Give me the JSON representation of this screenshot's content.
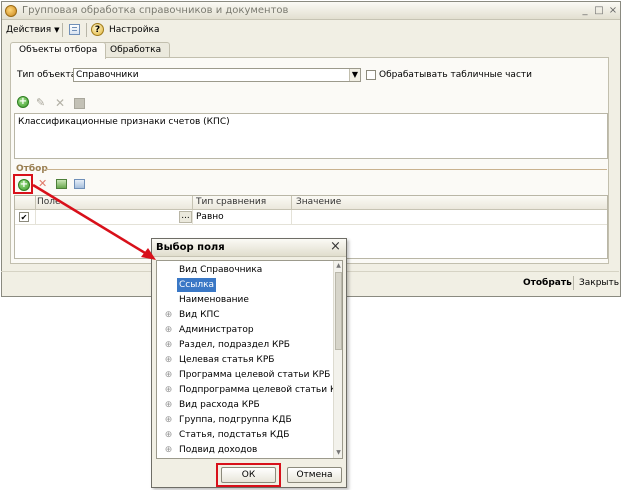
{
  "window": {
    "title": "Групповая обработка справочников и документов",
    "controls": [
      "_",
      "□",
      "×"
    ]
  },
  "toolbar": {
    "actions_label": "Действия",
    "settings_label": "Настройка",
    "help_icon": "?"
  },
  "tabs": [
    {
      "label": "Объекты отбора",
      "active": true
    },
    {
      "label": "Обработка",
      "active": false
    }
  ],
  "object_type": {
    "label": "Тип объекта:",
    "value": "Справочники",
    "process_tables_label": "Обрабатывать табличные части",
    "process_tables_checked": false
  },
  "objects_list": {
    "items": [
      "Классификационные признаки счетов (КПС)"
    ]
  },
  "filter": {
    "section_title": "Отбор",
    "columns": [
      "Поле",
      "Тип сравнения",
      "Значение"
    ],
    "rows": [
      {
        "checked": true,
        "field": "",
        "ellipsis": "...",
        "comparison": "Равно",
        "value": ""
      }
    ]
  },
  "bottom": {
    "select_button": "Отобрать",
    "close_button": "Закрыть"
  },
  "dialog": {
    "title": "Выбор поля",
    "close_icon": "×",
    "items": [
      {
        "label": "Вид Справочника",
        "expandable": false,
        "selected": false
      },
      {
        "label": "Ссылка",
        "expandable": false,
        "selected": true
      },
      {
        "label": "Наименование",
        "expandable": false,
        "selected": false
      },
      {
        "label": "Вид КПС",
        "expandable": true,
        "selected": false
      },
      {
        "label": "Администратор",
        "expandable": true,
        "selected": false
      },
      {
        "label": "Раздел, подраздел КРБ",
        "expandable": true,
        "selected": false
      },
      {
        "label": "Целевая статья КРБ",
        "expandable": true,
        "selected": false
      },
      {
        "label": "Программа целевой статьи КРБ",
        "expandable": true,
        "selected": false
      },
      {
        "label": "Подпрограмма целевой статьи КРБ",
        "expandable": true,
        "selected": false
      },
      {
        "label": "Вид расхода КРБ",
        "expandable": true,
        "selected": false
      },
      {
        "label": "Группа, подгруппа КДБ",
        "expandable": true,
        "selected": false
      },
      {
        "label": "Статья, подстатья КДБ",
        "expandable": true,
        "selected": false
      },
      {
        "label": "Подвид доходов",
        "expandable": true,
        "selected": false
      }
    ],
    "ok_label": "ОК",
    "cancel_label": "Отмена"
  },
  "colors": {
    "highlight_red": "#d8101a",
    "selection_blue": "#3a78c6",
    "window_bg": "#f1efe4",
    "filter_title": "#9a7f52"
  }
}
